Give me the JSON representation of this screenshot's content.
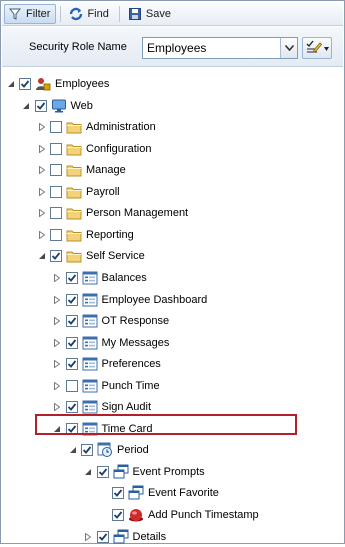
{
  "toolbar": {
    "filter_label": "Filter",
    "find_label": "Find",
    "save_label": "Save"
  },
  "role": {
    "label": "Security Role Name",
    "value": "Employees"
  },
  "tree": [
    {
      "label": "Employees",
      "icon": "role-icon",
      "level": 0,
      "expander": "expanded",
      "checked": true
    },
    {
      "label": "Web",
      "icon": "monitor-icon",
      "level": 1,
      "expander": "expanded",
      "checked": true
    },
    {
      "label": "Administration",
      "icon": "folder-icon",
      "level": 2,
      "expander": "collapsed",
      "checked": false
    },
    {
      "label": "Configuration",
      "icon": "folder-icon",
      "level": 2,
      "expander": "collapsed",
      "checked": false
    },
    {
      "label": "Manage",
      "icon": "folder-icon",
      "level": 2,
      "expander": "collapsed",
      "checked": false
    },
    {
      "label": "Payroll",
      "icon": "folder-icon",
      "level": 2,
      "expander": "collapsed",
      "checked": false
    },
    {
      "label": "Person Management",
      "icon": "folder-icon",
      "level": 2,
      "expander": "collapsed",
      "checked": false
    },
    {
      "label": "Reporting",
      "icon": "folder-icon",
      "level": 2,
      "expander": "collapsed",
      "checked": false
    },
    {
      "label": "Self Service",
      "icon": "folder-icon",
      "level": 2,
      "expander": "expanded",
      "checked": true
    },
    {
      "label": "Balances",
      "icon": "form-icon",
      "level": 3,
      "expander": "collapsed",
      "checked": true
    },
    {
      "label": "Employee Dashboard",
      "icon": "form-icon",
      "level": 3,
      "expander": "collapsed",
      "checked": true
    },
    {
      "label": "OT Response",
      "icon": "form-icon",
      "level": 3,
      "expander": "collapsed",
      "checked": true
    },
    {
      "label": "My Messages",
      "icon": "form-icon",
      "level": 3,
      "expander": "collapsed",
      "checked": true
    },
    {
      "label": "Preferences",
      "icon": "form-icon",
      "level": 3,
      "expander": "collapsed",
      "checked": true
    },
    {
      "label": "Punch Time",
      "icon": "form-icon",
      "level": 3,
      "expander": "collapsed",
      "checked": false
    },
    {
      "label": "Sign Audit",
      "icon": "form-icon",
      "level": 3,
      "expander": "collapsed",
      "checked": true
    },
    {
      "label": "Time Card",
      "icon": "form-icon",
      "level": 3,
      "expander": "expanded",
      "checked": true
    },
    {
      "label": "Period",
      "icon": "period-icon",
      "level": 4,
      "expander": "expanded",
      "checked": true
    },
    {
      "label": "Event Prompts",
      "icon": "window-stack-icon",
      "level": 5,
      "expander": "expanded",
      "checked": true
    },
    {
      "label": "Event Favorite",
      "icon": "window-stack-icon",
      "level": 6,
      "expander": "none",
      "checked": true
    },
    {
      "label": "Add Punch Timestamp",
      "icon": "red-button-icon",
      "level": 6,
      "expander": "none",
      "checked": true
    },
    {
      "label": "Details",
      "icon": "window-stack-icon",
      "level": 5,
      "expander": "collapsed",
      "checked": true
    }
  ]
}
